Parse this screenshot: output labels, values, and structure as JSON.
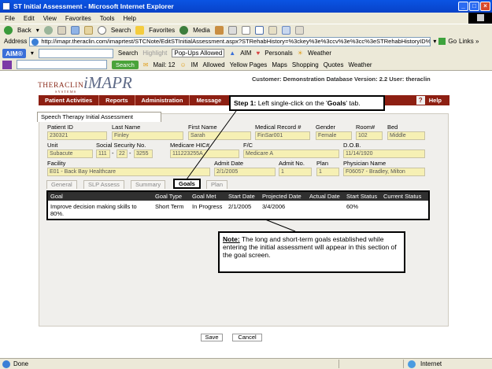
{
  "window": {
    "title": "ST Initial Assessment - Microsoft Internet Explorer",
    "controls": [
      "_",
      "□",
      "×"
    ]
  },
  "menu": [
    "File",
    "Edit",
    "View",
    "Favorites",
    "Tools",
    "Help"
  ],
  "toolbar": {
    "back": "Back",
    "search": "Search",
    "favorites": "Favorites",
    "media": "Media"
  },
  "address": {
    "label": "Address",
    "url": "http://imapr.theraclin.com/imaprtest/STCNote/EditSTInitialAssessment.aspx?STRehabHistory=%3ckey%3e%3ccv%3e%3cc%3eSTRehabHistoryID%3c",
    "go": "Go",
    "links": "Links »"
  },
  "aim_bar": {
    "logo": "AIM®",
    "search": "Search",
    "highlight": "Highlight",
    "popups": "Pop-Ups Allowed",
    "aim": "AIM",
    "personals": "Personals",
    "weather": "Weather"
  },
  "yahoo_bar": {
    "search_btn": "Search",
    "mail": "Mail: 12",
    "im": "IM",
    "allowed": "Allowed",
    "yellow_pages": "Yellow Pages",
    "maps": "Maps",
    "shopping": "Shopping",
    "quotes": "Quotes",
    "weather": "Weather"
  },
  "brand": {
    "theraclin": "THERACLIN",
    "systems": "SYSTEMS",
    "imapr": "iMAPR",
    "customer": "Customer: Demonstration Database Version: 2.2 User: theraclin"
  },
  "nav": {
    "items": [
      "Patient Activities",
      "Reports",
      "Administration",
      "Message"
    ],
    "help": "Help"
  },
  "form": {
    "tab": "Speech Therapy Initial Assessment",
    "labels": {
      "patient_id": "Patient ID",
      "last_name": "Last Name",
      "first_name": "First Name",
      "medical_record": "Medical Record #",
      "gender": "Gender",
      "room": "Room#",
      "bed": "Bed",
      "unit": "Unit",
      "ssn": "Social Security No.",
      "medicare": "Medicare HIC#",
      "fc": "F/C",
      "dob": "D.O.B.",
      "facility": "Facility",
      "admit_date": "Admit Date",
      "admit_no": "Admit No.",
      "plan": "Plan",
      "physician": "Physician Name"
    },
    "values": {
      "patient_id": "230321",
      "last_name": "Finley",
      "first_name": "Sarah",
      "medical_record": "FinSar001",
      "gender": "Female",
      "room": "102",
      "bed": "Middle",
      "unit": "Subacute",
      "ssn1": "111",
      "ssn2": "22",
      "ssn3": "3255",
      "medicare": "111223255A",
      "fc": "Medicare A",
      "dob": "11/14/1920",
      "facility": "E01 - Back Bay Healthcare",
      "admit_date": "2/1/2005",
      "admit_no": "1",
      "plan": "1",
      "physician": "F06057 - Bradley, Milton"
    },
    "ssn_sep": "-"
  },
  "subtabs": [
    "General",
    "SLP Assess",
    "Summary",
    "Goals",
    "Plan"
  ],
  "grid": {
    "headers": [
      "Goal",
      "Goal Type",
      "Goal Met",
      "Start Date",
      "Projected Date",
      "Actual Date",
      "Start Status",
      "Current Status"
    ],
    "rows": [
      {
        "goal": "Improve decision making skills to 80%.",
        "goal_type": "Short Term",
        "goal_met": "In Progress",
        "start_date": "2/1/2005",
        "projected_date": "3/4/2006",
        "actual_date": "",
        "start_status": "60%",
        "current_status": ""
      }
    ]
  },
  "callouts": {
    "step_prefix": "Step 1:",
    "step_text": " Left single-click on the '",
    "step_bold": "Goals",
    "step_suffix": "' tab.",
    "note_prefix": "Note:",
    "note_text": " The long and short-term goals established while entering the initial assessment will appear in this section of the goal screen."
  },
  "buttons": {
    "save": "Save",
    "cancel": "Cancel"
  },
  "status": {
    "left": "Done",
    "zone": "Internet"
  },
  "colors": {
    "nav_bg": "#8d1f12",
    "field_bg": "#f6f0b4",
    "grid_header": "#303030",
    "titlebar": "#0a54e3"
  }
}
